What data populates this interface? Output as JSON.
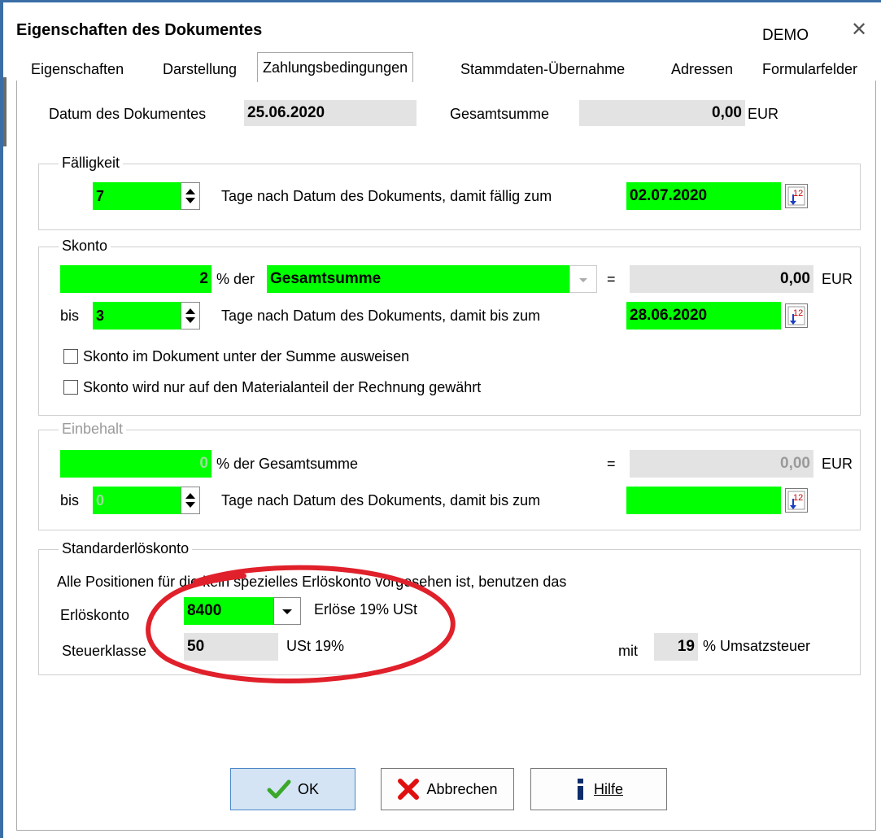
{
  "window": {
    "title": "Eigenschaften des Dokumentes",
    "demo_label": "DEMO",
    "close_glyph": "✕"
  },
  "tabs": [
    {
      "label": "Eigenschaften",
      "active": false
    },
    {
      "label": "Darstellung",
      "active": false
    },
    {
      "label": "Zahlungsbedingungen",
      "active": true
    },
    {
      "label": "Stammdaten-Übernahme",
      "active": false
    },
    {
      "label": "Adressen",
      "active": false
    },
    {
      "label": "Formularfelder",
      "active": false
    }
  ],
  "header": {
    "datum_label": "Datum des Dokumentes",
    "datum_value": "25.06.2020",
    "gesamtsumme_label": "Gesamtsumme",
    "gesamtsumme_value": "0,00",
    "currency": "EUR"
  },
  "faelligkeit": {
    "legend": "Fälligkeit",
    "days_value": "7",
    "text": "Tage nach Datum des Dokuments, damit fällig zum",
    "date_value": "02.07.2020"
  },
  "skonto": {
    "legend": "Skonto",
    "percent_value": "2",
    "percent_label": "% der",
    "base_value": "Gesamtsumme",
    "equals": "=",
    "amount_value": "0,00",
    "currency": "EUR",
    "bis_label": "bis",
    "days_value": "3",
    "text": "Tage nach Datum des Dokuments, damit bis zum",
    "date_value": "28.06.2020",
    "check1_label": "Skonto im Dokument unter der Summe ausweisen",
    "check2_label": "Skonto wird nur auf den Materialanteil der Rechnung gewährt"
  },
  "einbehalt": {
    "legend": "Einbehalt",
    "percent_value": "0",
    "percent_label": "% der Gesamtsumme",
    "equals": "=",
    "amount_value": "0,00",
    "currency": "EUR",
    "bis_label": "bis",
    "days_value": "0",
    "text": "Tage nach Datum des Dokuments, damit bis zum",
    "date_value": ""
  },
  "erloes": {
    "legend": "Standarderlöskonto",
    "description": "Alle Positionen für die kein spezielles Erlöskonto vorgesehen ist, benutzen das",
    "konto_label": "Erlöskonto",
    "konto_value": "8400",
    "konto_desc": "Erlöse 19% USt",
    "steuer_label": "Steuerklasse",
    "steuer_value": "50",
    "steuer_desc": "USt 19%",
    "mit_label": "mit",
    "rate_value": "19",
    "rate_label": "% Umsatzsteuer"
  },
  "buttons": {
    "ok": "OK",
    "cancel": "Abbrechen",
    "help": "Hilfe"
  },
  "colors": {
    "field_green": "#00ff00",
    "annotation_red": "#e0202a",
    "frame_blue": "#3a6ea5"
  }
}
